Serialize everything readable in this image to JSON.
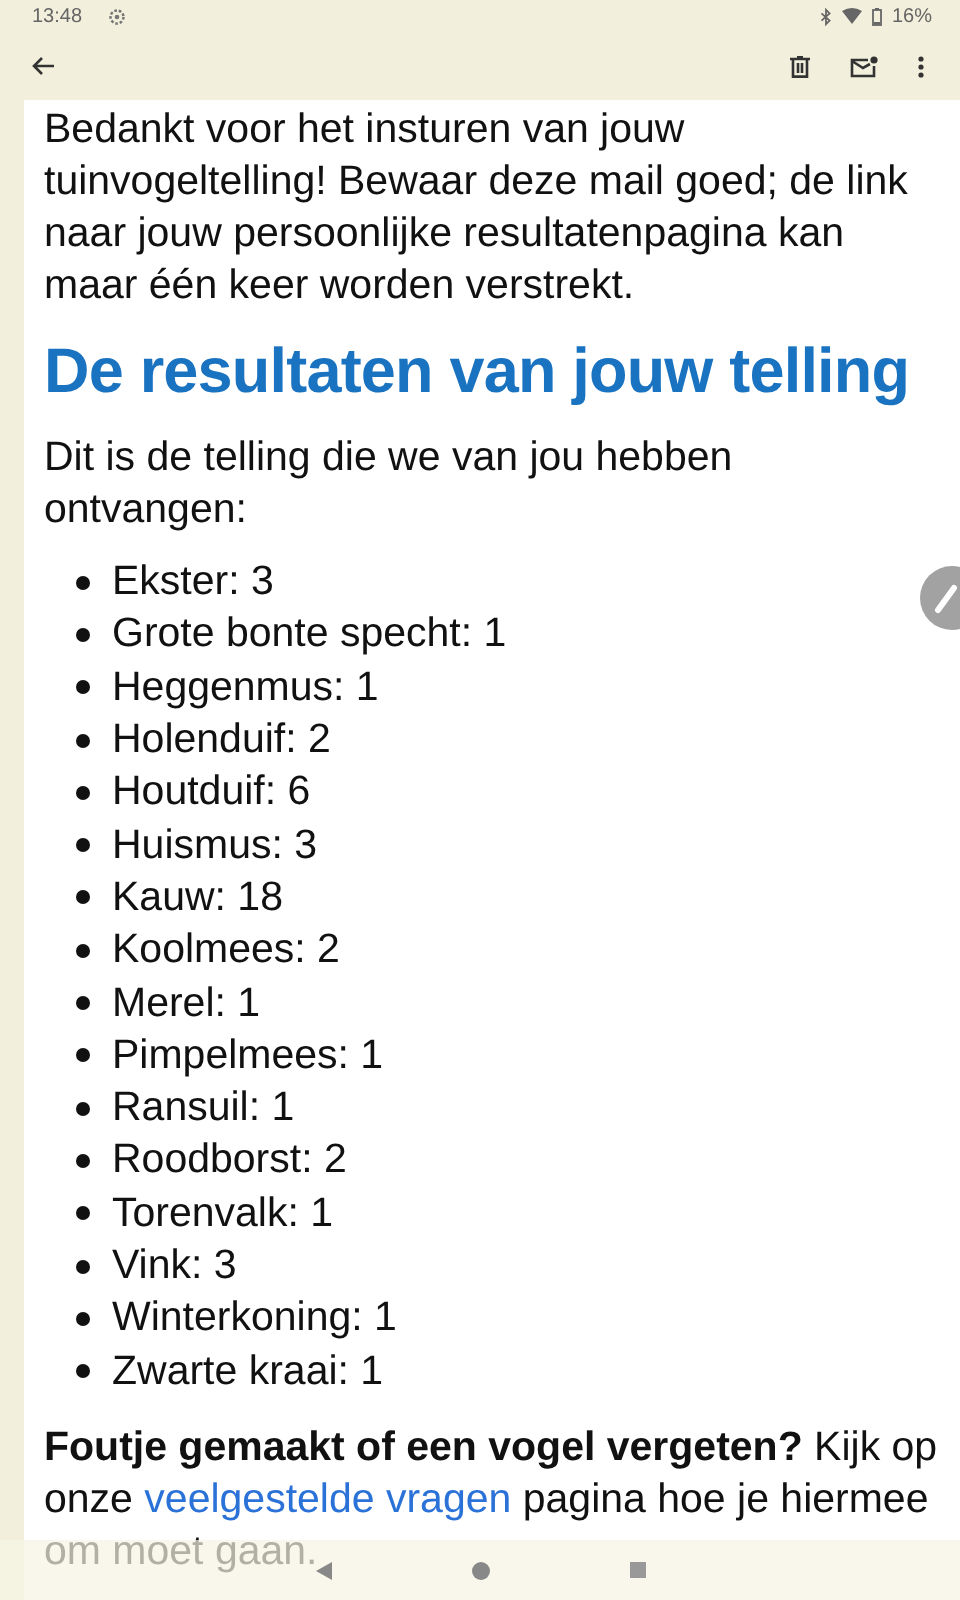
{
  "status_bar": {
    "time": "13:48",
    "battery": "16%"
  },
  "message": {
    "intro": "Bedankt voor het insturen van jouw tuinvogeltelling! Bewaar deze mail goed; de link naar jouw persoonlijke resultatenpagina kan maar één keer worden verstrekt.",
    "heading": "De resultaten van jouw telling",
    "lead": "Dit is de telling die we van jou hebben ontvangen:",
    "counts": [
      "Ekster: 3",
      "Grote bonte specht: 1",
      "Heggenmus: 1",
      "Holenduif: 2",
      "Houtduif: 6",
      "Huismus: 3",
      "Kauw: 18",
      "Koolmees: 2",
      "Merel: 1",
      "Pimpelmees: 1",
      "Ransuil: 1",
      "Roodborst: 2",
      "Torenvalk: 1",
      "Vink: 3",
      "Winterkoning: 1",
      "Zwarte kraai: 1"
    ],
    "footer": {
      "before": "**Foutje gemaakt of een vogel vergeten?** Kijk op onze",
      "link": "veelgestelde vragen",
      "after": "pagina hoe je hiermee om moet gaan."
    }
  }
}
